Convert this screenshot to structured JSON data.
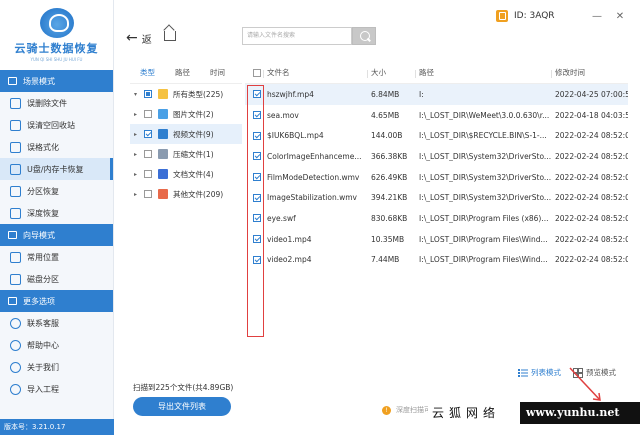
{
  "app": {
    "title": "云骑士数据恢复",
    "subtitle": "YUN QI SHI SHU JU HUI FU",
    "version": "版本号：3.21.0.17",
    "id_text": "ID: 3AQR",
    "accent": "#2f7fcf"
  },
  "sidebar": {
    "sections": [
      {
        "title": "场景模式",
        "icon": "scene-icon"
      },
      {
        "title": "向导模式",
        "icon": "wizard-icon"
      },
      {
        "title": "更多选项",
        "icon": "menu-icon"
      }
    ],
    "scene_items": [
      {
        "label": "误删除文件",
        "icon": "delete-file-icon"
      },
      {
        "label": "误清空回收站",
        "icon": "recycle-bin-icon"
      },
      {
        "label": "误格式化",
        "icon": "format-icon"
      },
      {
        "label": "U盘/内存卡恢复",
        "icon": "usb-icon",
        "active": true
      },
      {
        "label": "分区恢复",
        "icon": "partition-icon"
      },
      {
        "label": "深度恢复",
        "icon": "deep-recover-icon"
      }
    ],
    "wizard_items": [
      {
        "label": "常用位置",
        "icon": "location-icon"
      },
      {
        "label": "磁盘分区",
        "icon": "disk-icon"
      }
    ],
    "more_items": [
      {
        "label": "联系客服",
        "icon": "service-icon"
      },
      {
        "label": "帮助中心",
        "icon": "help-icon"
      },
      {
        "label": "关于我们",
        "icon": "info-icon"
      },
      {
        "label": "导入工程",
        "icon": "import-icon"
      }
    ]
  },
  "topbar": {
    "back_label": "返",
    "home_label": "回",
    "search_placeholder": "请输入文件名搜索"
  },
  "tree": {
    "tabs": [
      "类型",
      "路径",
      "时间"
    ],
    "rows": [
      {
        "label": "所有类型(225)",
        "icon": "folder-icon",
        "color": "#f5c242",
        "state": "partial",
        "caret": "▾"
      },
      {
        "label": "图片文件(2)",
        "icon": "image-file-icon",
        "color": "#4aa0e6",
        "state": "none",
        "caret": "▸"
      },
      {
        "label": "视频文件(9)",
        "icon": "video-file-icon",
        "color": "#2f7fcf",
        "state": "checked",
        "caret": "▸"
      },
      {
        "label": "压缩文件(1)",
        "icon": "zip-file-icon",
        "color": "#8a9bb0",
        "state": "none",
        "caret": "▸"
      },
      {
        "label": "文档文件(4)",
        "icon": "doc-file-icon",
        "color": "#3b6fd6",
        "state": "none",
        "caret": "▸"
      },
      {
        "label": "其他文件(209)",
        "icon": "other-file-icon",
        "color": "#e86a4a",
        "state": "none",
        "caret": "▸"
      }
    ]
  },
  "table": {
    "columns": [
      "文件名",
      "大小",
      "路径",
      "修改时间"
    ],
    "rows": [
      {
        "name": "hszwjhf.mp4",
        "size": "6.84MB",
        "path": "I:",
        "time": "2022-04-25 07:00:52"
      },
      {
        "name": "sea.mov",
        "size": "4.65MB",
        "path": "I:\\_LOST_DIR\\WeMeet\\3.0.0.630\\r...",
        "time": "2022-04-18 04:03:57"
      },
      {
        "name": "$IUK6BQL.mp4",
        "size": "144.00B",
        "path": "I:\\_LOST_DIR\\$RECYCLE.BIN\\S-1-...",
        "time": "2022-02-24 08:52:03"
      },
      {
        "name": "ColorImageEnhanceme...",
        "size": "366.38KB",
        "path": "I:\\_LOST_DIR\\System32\\DriverSto...",
        "time": "2022-02-24 08:52:02"
      },
      {
        "name": "FilmModeDetection.wmv",
        "size": "626.49KB",
        "path": "I:\\_LOST_DIR\\System32\\DriverSto...",
        "time": "2022-02-24 08:52:03"
      },
      {
        "name": "ImageStabilization.wmv",
        "size": "394.21KB",
        "path": "I:\\_LOST_DIR\\System32\\DriverSto...",
        "time": "2022-02-24 08:52:03"
      },
      {
        "name": "eye.swf",
        "size": "830.68KB",
        "path": "I:\\_LOST_DIR\\Program Files (x86)...",
        "time": "2022-02-24 08:52:03"
      },
      {
        "name": "video1.mp4",
        "size": "10.35MB",
        "path": "I:\\_LOST_DIR\\Program Files\\Wind...",
        "time": "2022-02-24 08:52:05"
      },
      {
        "name": "video2.mp4",
        "size": "7.44MB",
        "path": "I:\\_LOST_DIR\\Program Files\\Wind...",
        "time": "2022-02-24 08:52:05"
      }
    ]
  },
  "bottom": {
    "scan_summary": "扫描到225个文件(共4.89GB)",
    "export_label": "导出文件列表",
    "list_mode": "列表模式",
    "preview_mode": "预览模式",
    "deep_scan": "深度扫描可..."
  },
  "watermark": {
    "cn": "云狐网络",
    "url": "www.yunhu.net"
  }
}
